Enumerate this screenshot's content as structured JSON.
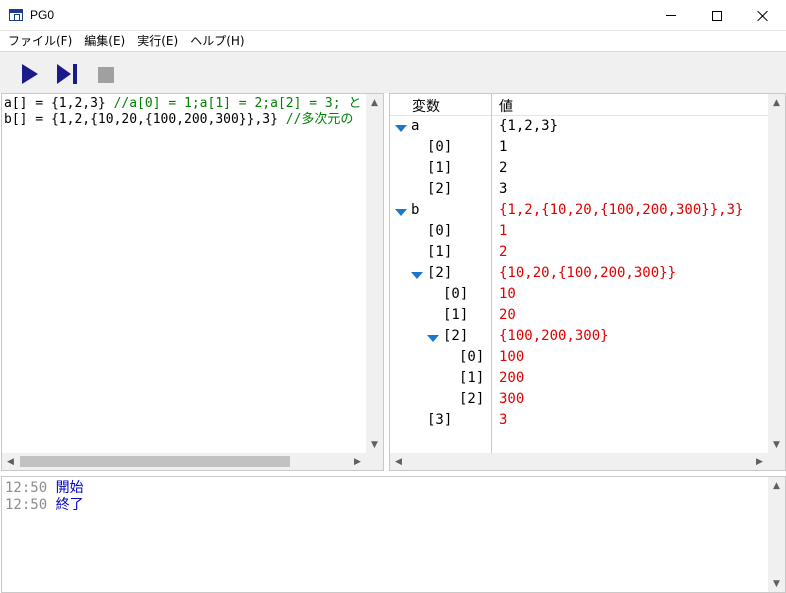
{
  "window": {
    "title": "PG0"
  },
  "menu": [
    {
      "label": "ファイル(F)"
    },
    {
      "label": "編集(E)"
    },
    {
      "label": "実行(E)"
    },
    {
      "label": "ヘルプ(H)"
    }
  ],
  "toolbar": {
    "run_icon": "play-icon",
    "step_icon": "step-forward-icon",
    "stop_icon": "stop-icon",
    "colors": {
      "run": "#1a1a8c",
      "stop": "#a0a0a0"
    }
  },
  "editor": {
    "lines": [
      {
        "code": "a[] = {1,2,3} ",
        "comment": "//a[0] = 1;a[1] = 2;a[2] = 3; と"
      },
      {
        "code": "b[] = {1,2,{10,20,{100,200,300}},3} ",
        "comment": "//多次元の"
      }
    ]
  },
  "variables": {
    "col_name": "変数",
    "col_value": "値",
    "rows": [
      {
        "name": "a",
        "value": "{1,2,3}",
        "color": "#000000"
      },
      {
        "name": "[0]",
        "value": "1",
        "color": "#000000"
      },
      {
        "name": "[1]",
        "value": "2",
        "color": "#000000"
      },
      {
        "name": "[2]",
        "value": "3",
        "color": "#000000"
      },
      {
        "name": "b",
        "value": "{1,2,{10,20,{100,200,300}},3}",
        "color": "#e00000"
      },
      {
        "name": "[0]",
        "value": "1",
        "color": "#e00000"
      },
      {
        "name": "[1]",
        "value": "2",
        "color": "#e00000"
      },
      {
        "name": "[2]",
        "value": "{10,20,{100,200,300}}",
        "color": "#e00000"
      },
      {
        "name": "[0]",
        "value": "10",
        "color": "#e00000"
      },
      {
        "name": "[1]",
        "value": "20",
        "color": "#e00000"
      },
      {
        "name": "[2]",
        "value": "{100,200,300}",
        "color": "#e00000"
      },
      {
        "name": "[0]",
        "value": "100",
        "color": "#e00000"
      },
      {
        "name": "[1]",
        "value": "200",
        "color": "#e00000"
      },
      {
        "name": "[2]",
        "value": "300",
        "color": "#e00000"
      },
      {
        "name": "[3]",
        "value": "3",
        "color": "#e00000"
      }
    ]
  },
  "console": {
    "lines": [
      {
        "time": "12:50",
        "message": "開始"
      },
      {
        "time": "12:50",
        "message": "終了"
      }
    ]
  }
}
